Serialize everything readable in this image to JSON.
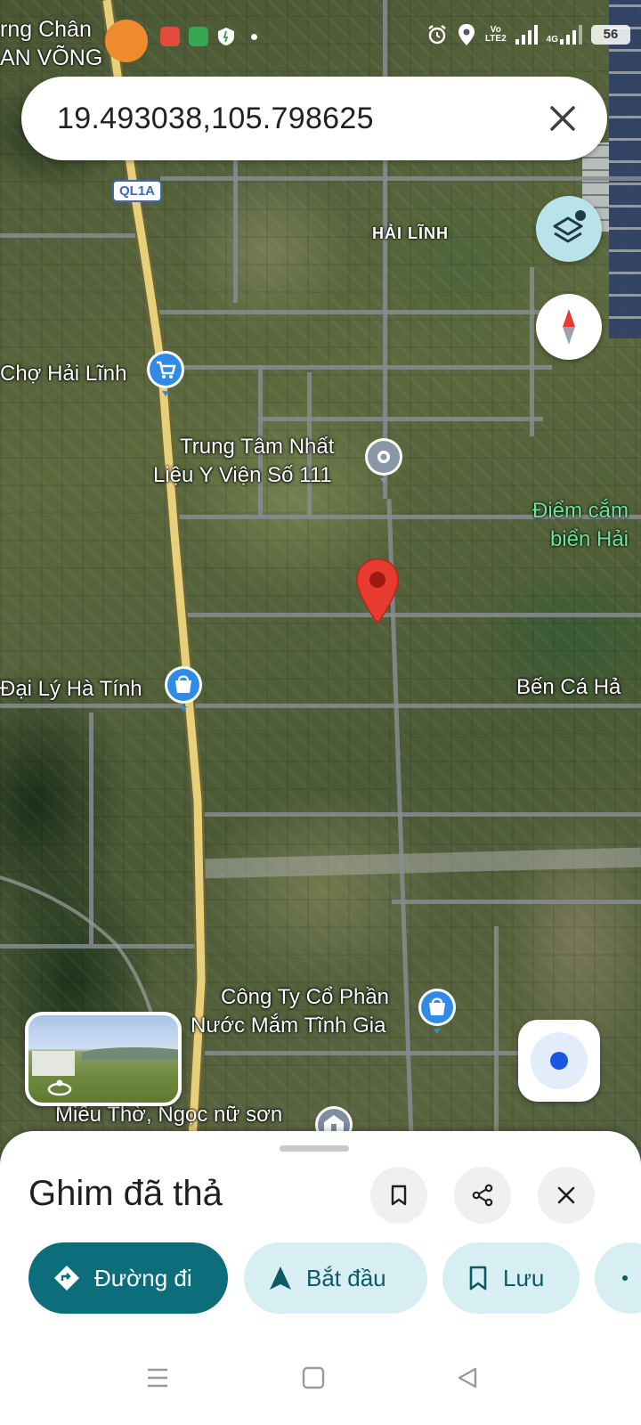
{
  "status_bar": {
    "notification_icons": [
      "app-icon-orange",
      "app-icon-red",
      "app-icon-green",
      "shield-icon"
    ],
    "network": "Vo LTE2",
    "network_top": "Vo",
    "network_bottom": "LTE2",
    "network2": "4G",
    "battery": "56"
  },
  "overlay_texts": {
    "top_left_1": "rng Chân",
    "top_left_2": "AN VÕNG"
  },
  "search": {
    "value": "19.493038,105.798625"
  },
  "map": {
    "route_shield": "QL1A",
    "area_label": "HẢI LĨNH",
    "places": {
      "market": "Chợ Hải Lĩnh",
      "center_line1": "Trung Tâm Nhất",
      "center_line2": "Liệu Y Viện Số 111",
      "green_line1": "Điểm cắm",
      "green_line2": "biển Hải",
      "agency": "Đại Lý Hà Tính",
      "port": "Bến Cá Hả",
      "company_line1": "Công Ty Cổ Phần",
      "company_line2": "Nước Mắm Tĩnh Gia",
      "temple": "Miếu Thờ, Ngọc nữ sơn"
    },
    "icons": {
      "market": "shopping-cart-icon",
      "center": "place-icon",
      "agency": "shopping-bag-icon",
      "company": "shopping-bag-icon",
      "temple": "temple-icon",
      "pin": "dropped-pin-icon"
    },
    "colors": {
      "poi_blue": "#2f8be6",
      "pin_red": "#e63b2e",
      "place_grey": "#8a98a6",
      "temple_grey": "#7f8ea0",
      "accent": "#0b6e7a"
    }
  },
  "controls": {
    "layers": "layers-icon",
    "compass": "compass-icon",
    "my_location": "my-location-icon",
    "street_view": "street-view-thumbnail"
  },
  "sheet": {
    "title": "Ghim đã thả",
    "actions": {
      "directions": "Đường đi",
      "start": "Bắt đầu",
      "save": "Lưu"
    }
  },
  "navbar": [
    "menu-icon",
    "home-icon",
    "back-icon"
  ]
}
